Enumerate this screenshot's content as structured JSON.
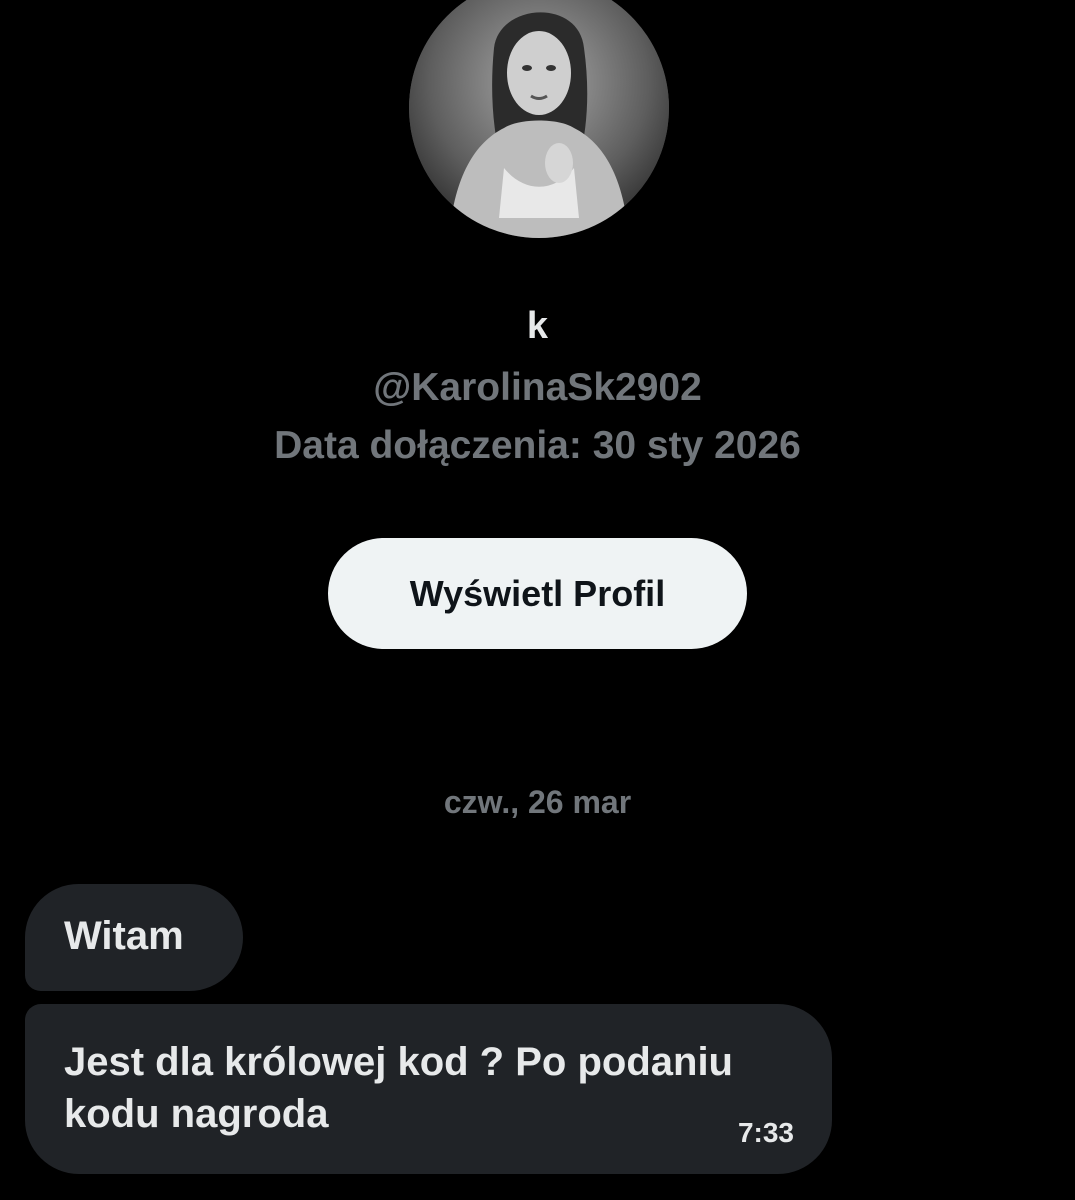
{
  "profile": {
    "avatar_icon": "profile-photo",
    "display_name": "k",
    "handle": "@KarolinaSk2902",
    "joined": "Data dołączenia: 30 sty 2026",
    "view_profile_label": "Wyświetl Profil"
  },
  "conversation": {
    "date_separator": "czw., 26 mar",
    "messages": [
      {
        "text": "Witam"
      },
      {
        "text": "Jest dla królowej kod ? Po podaniu kodu nagroda",
        "time": "7:33"
      }
    ]
  },
  "colors": {
    "background": "#000000",
    "primary_text": "#e7e9ea",
    "secondary_text": "#71767b",
    "bubble": "#202327",
    "button_bg": "#eff3f4",
    "button_text": "#0f1419"
  }
}
